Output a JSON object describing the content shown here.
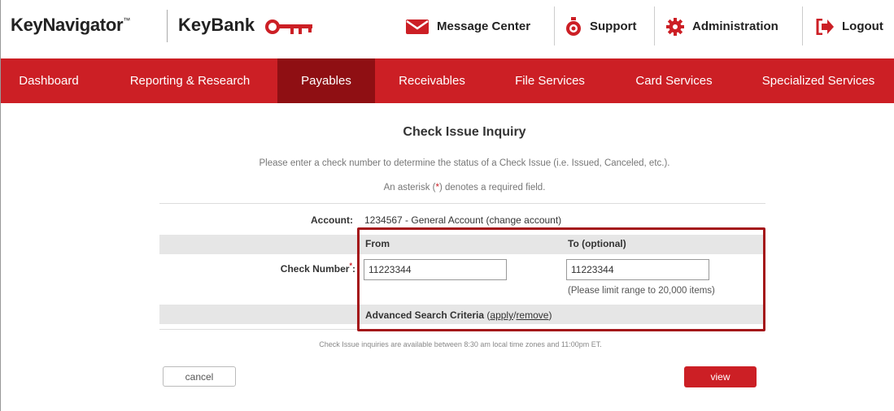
{
  "header": {
    "brand": "KeyNavigator",
    "brand_mark": "™",
    "bank": "KeyBank",
    "links": {
      "messages": "Message Center",
      "support": "Support",
      "admin": "Administration",
      "logout": "Logout"
    }
  },
  "nav": {
    "items": [
      {
        "label": "Dashboard"
      },
      {
        "label": "Reporting & Research"
      },
      {
        "label": "Payables"
      },
      {
        "label": "Receivables"
      },
      {
        "label": "File Services"
      },
      {
        "label": "Card Services"
      },
      {
        "label": "Specialized Services"
      }
    ],
    "active": "Payables"
  },
  "page": {
    "title": "Check Issue Inquiry",
    "description": "Please enter a check number to determine the status of a Check Issue (i.e. Issued, Canceled, etc.).",
    "required_pre": "An asterisk (",
    "required_star": "*",
    "required_post": ") denotes a required field."
  },
  "form": {
    "account_label": "Account:",
    "account_value": "1234567 - General Account",
    "change_account": "(change account)",
    "from_header": "From",
    "to_header": "To (optional)",
    "check_label": "Check Number",
    "check_star": "*",
    "check_colon": ":",
    "from_value": "11223344",
    "to_value": "11223344",
    "limit_note": "(Please limit range to 20,000 items)",
    "advanced_label": "Advanced Search Criteria",
    "adv_open": "(",
    "adv_apply": "apply",
    "adv_sep": "/",
    "adv_remove": "remove",
    "adv_close": ")",
    "availability": "Check Issue inquiries are available between 8:30 am local time zones and 11:00pm ET."
  },
  "buttons": {
    "cancel": "cancel",
    "view": "view"
  },
  "colors": {
    "brand_red": "#cc1f25",
    "active_nav": "#8f0f13",
    "highlight": "#a4161a"
  },
  "icons": {
    "messages": "envelope-icon",
    "support": "lifebuoy-icon",
    "admin": "gear-icon",
    "logout": "logout-arrow-icon",
    "logo": "key-icon"
  }
}
